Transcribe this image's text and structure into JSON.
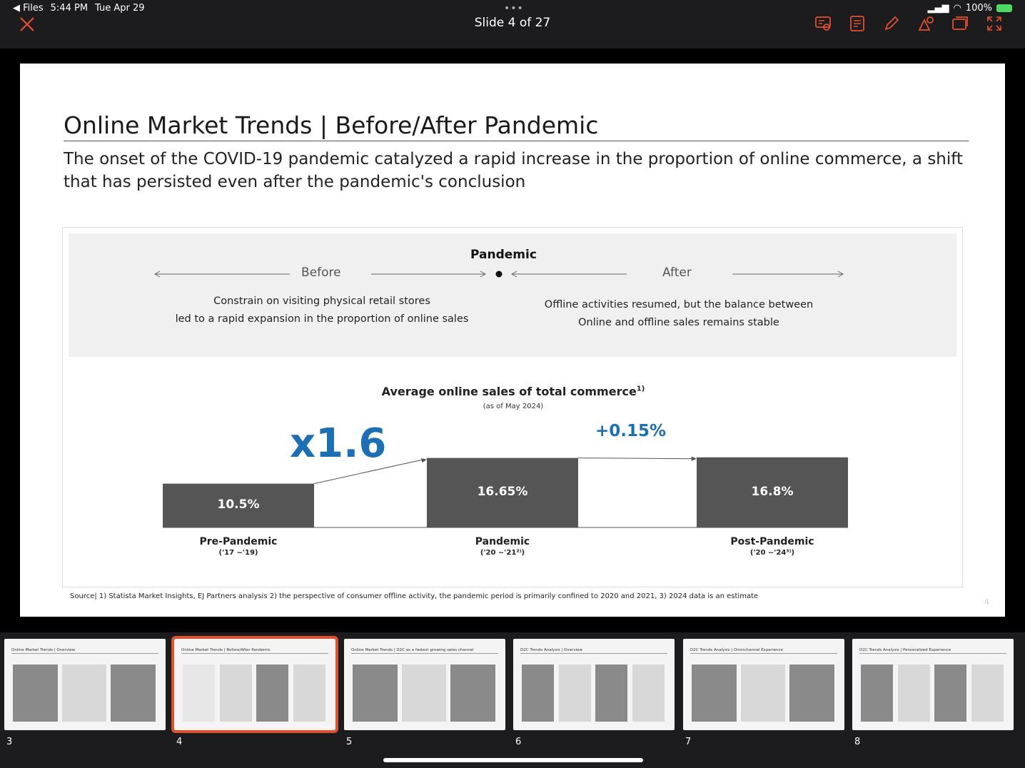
{
  "status": {
    "back_app": "◀ Files",
    "time": "5:44 PM",
    "date": "Tue Apr 29",
    "battery": "100%"
  },
  "toolbar": {
    "slide_counter": "Slide 4 of 27",
    "accent": "#e0502b"
  },
  "slide": {
    "title": "Online Market Trends | Before/After Pandemic",
    "subtitle": "The onset of the COVID-19 pandemic catalyzed a rapid increase in the proportion of online commerce, a shift that has persisted even after the pandemic's conclusion",
    "band": {
      "before_label": "Before",
      "pandemic_label": "Pandemic",
      "after_label": "After",
      "before_text_1": "Constrain on visiting physical retail stores",
      "before_text_2": "led to a rapid expansion in the proportion of online sales",
      "after_text_1": "Offline activities resumed, but the balance between",
      "after_text_2": "Online and offline sales remains stable"
    },
    "source": "Source| 1) Statista Market Insights, EJ Partners analysis 2) the perspective of consumer offline activity, the pandemic period is primarily confined to 2020 and 2021, 3) 2024 data is an estimate",
    "page_number": "4"
  },
  "chart_data": {
    "type": "bar",
    "title": "Average online sales of total commerce",
    "title_sup": "1)",
    "note": "(as of May 2024)",
    "categories": [
      "Pre-Pandemic",
      "Pandemic",
      "Post-Pandemic"
    ],
    "category_subs": [
      "('17 ~'19)",
      "('20 ~'21²⁾)",
      "('20 ~'24³⁾)"
    ],
    "values": [
      10.5,
      16.65,
      16.8
    ],
    "value_labels": [
      "10.5%",
      "16.65%",
      "16.8%"
    ],
    "annotations": [
      "x1.6",
      "+0.15%"
    ],
    "bar_color": "#555555",
    "annotation_color": "#1a6fb5"
  },
  "thumbnails": [
    {
      "num": "3",
      "title": "Online Market Trends | Overview"
    },
    {
      "num": "4",
      "title": "Online Market Trends | Before/After Pandemic"
    },
    {
      "num": "5",
      "title": "Online Market Trends | D2C as a fastest growing sales channel"
    },
    {
      "num": "6",
      "title": "D2C Trends Analysis | Overview"
    },
    {
      "num": "7",
      "title": "D2C Trends Analysis | Omnichannel Experience"
    },
    {
      "num": "8",
      "title": "D2C Trends Analysis | Personalized Experience"
    }
  ]
}
